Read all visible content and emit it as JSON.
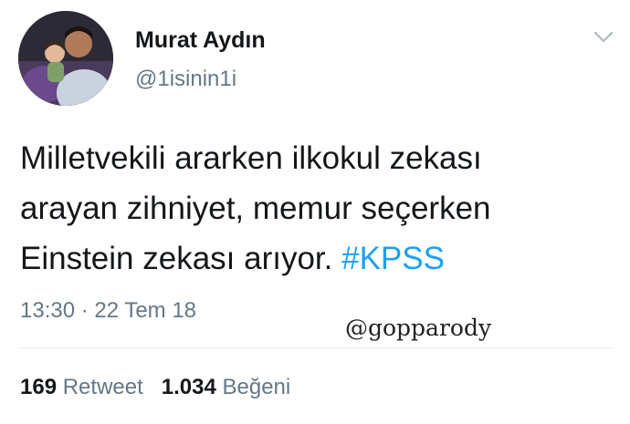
{
  "user": {
    "display_name": "Murat Aydın",
    "handle": "@1isinin1i"
  },
  "tweet": {
    "lines": [
      "Milletvekili ararken ilkokul zekası",
      "arayan zihniyet, memur seçerken",
      "Einstein zekası arıyor. "
    ],
    "hashtag": "#KPSS",
    "timestamp": "13:30 · 22 Tem 18"
  },
  "watermark": "@gopparody",
  "stats": {
    "retweets_count": "169",
    "retweets_label": "Retweet",
    "likes_count": "1.034",
    "likes_label": "Beğeni"
  },
  "icons": {
    "menu": "chevron-down-icon"
  },
  "colors": {
    "hashtag": "#1da1f2",
    "secondary_text": "#657786",
    "primary_text": "#14171a"
  }
}
